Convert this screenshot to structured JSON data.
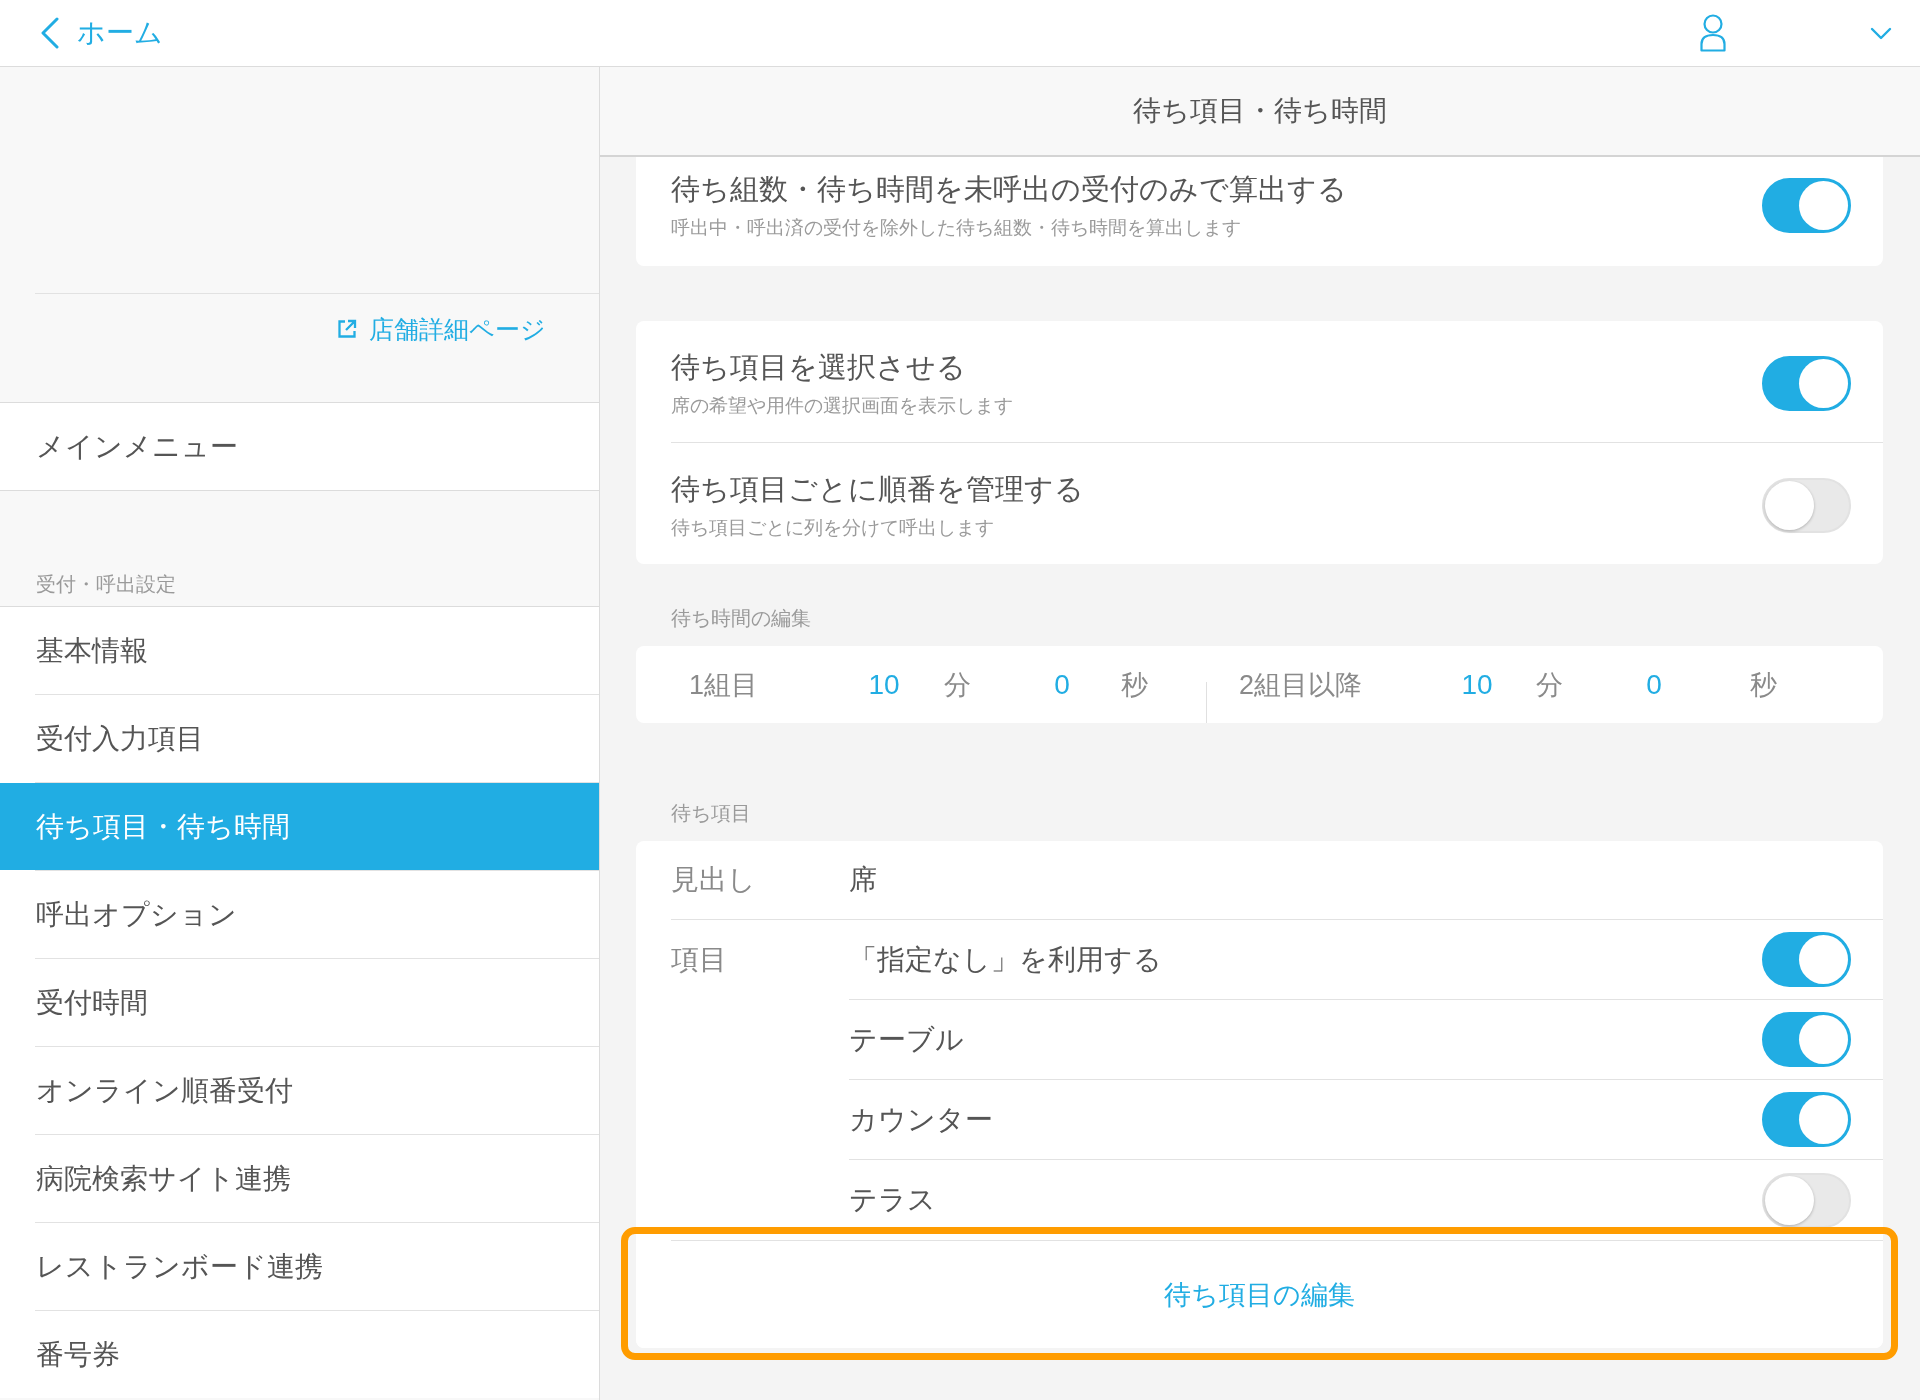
{
  "top_bar": {
    "back_label": "ホーム"
  },
  "sidebar": {
    "store_link": "店舗詳細ページ",
    "main_menu": "メインメニュー",
    "section_label": "受付・呼出設定",
    "items": [
      {
        "label": "基本情報",
        "selected": false
      },
      {
        "label": "受付入力項目",
        "selected": false
      },
      {
        "label": "待ち項目・待ち時間",
        "selected": true
      },
      {
        "label": "呼出オプション",
        "selected": false
      },
      {
        "label": "受付時間",
        "selected": false
      },
      {
        "label": "オンライン順番受付",
        "selected": false
      },
      {
        "label": "病院検索サイト連携",
        "selected": false
      },
      {
        "label": "レストランボード連携",
        "selected": false
      },
      {
        "label": "番号券",
        "selected": false
      }
    ]
  },
  "panel": {
    "title": "待ち項目・待ち時間"
  },
  "setting_cards": [
    {
      "rows": [
        {
          "title": "待ち組数・待ち時間を未呼出の受付のみで算出する",
          "description": "呼出中・呼出済の受付を除外した待ち組数・待ち時間を算出します",
          "on": true
        }
      ]
    },
    {
      "rows": [
        {
          "title": "待ち項目を選択させる",
          "description": "席の希望や用件の選択画面を表示します",
          "on": true
        },
        {
          "title": "待ち項目ごとに順番を管理する",
          "description": "待ち項目ごとに列を分けて呼出します",
          "on": false
        }
      ]
    }
  ],
  "wait_time": {
    "label": "待ち時間の編集",
    "entries": [
      {
        "label": "1組目",
        "minutes": "10",
        "minutes_unit": "分",
        "seconds": "0",
        "seconds_unit": "秒"
      },
      {
        "label": "2組目以降",
        "minutes": "10",
        "minutes_unit": "分",
        "seconds": "0",
        "seconds_unit": "秒"
      }
    ]
  },
  "wait_items": {
    "label": "待ち項目",
    "heading_label": "見出し",
    "heading_value": "席",
    "items_label": "項目",
    "items": [
      {
        "label": "「指定なし」を利用する",
        "on": true
      },
      {
        "label": "テーブル",
        "on": true
      },
      {
        "label": "カウンター",
        "on": true
      },
      {
        "label": "テラス",
        "on": false
      }
    ],
    "edit_button": {
      "label": "待ち項目の編集",
      "highlighted": true
    }
  }
}
